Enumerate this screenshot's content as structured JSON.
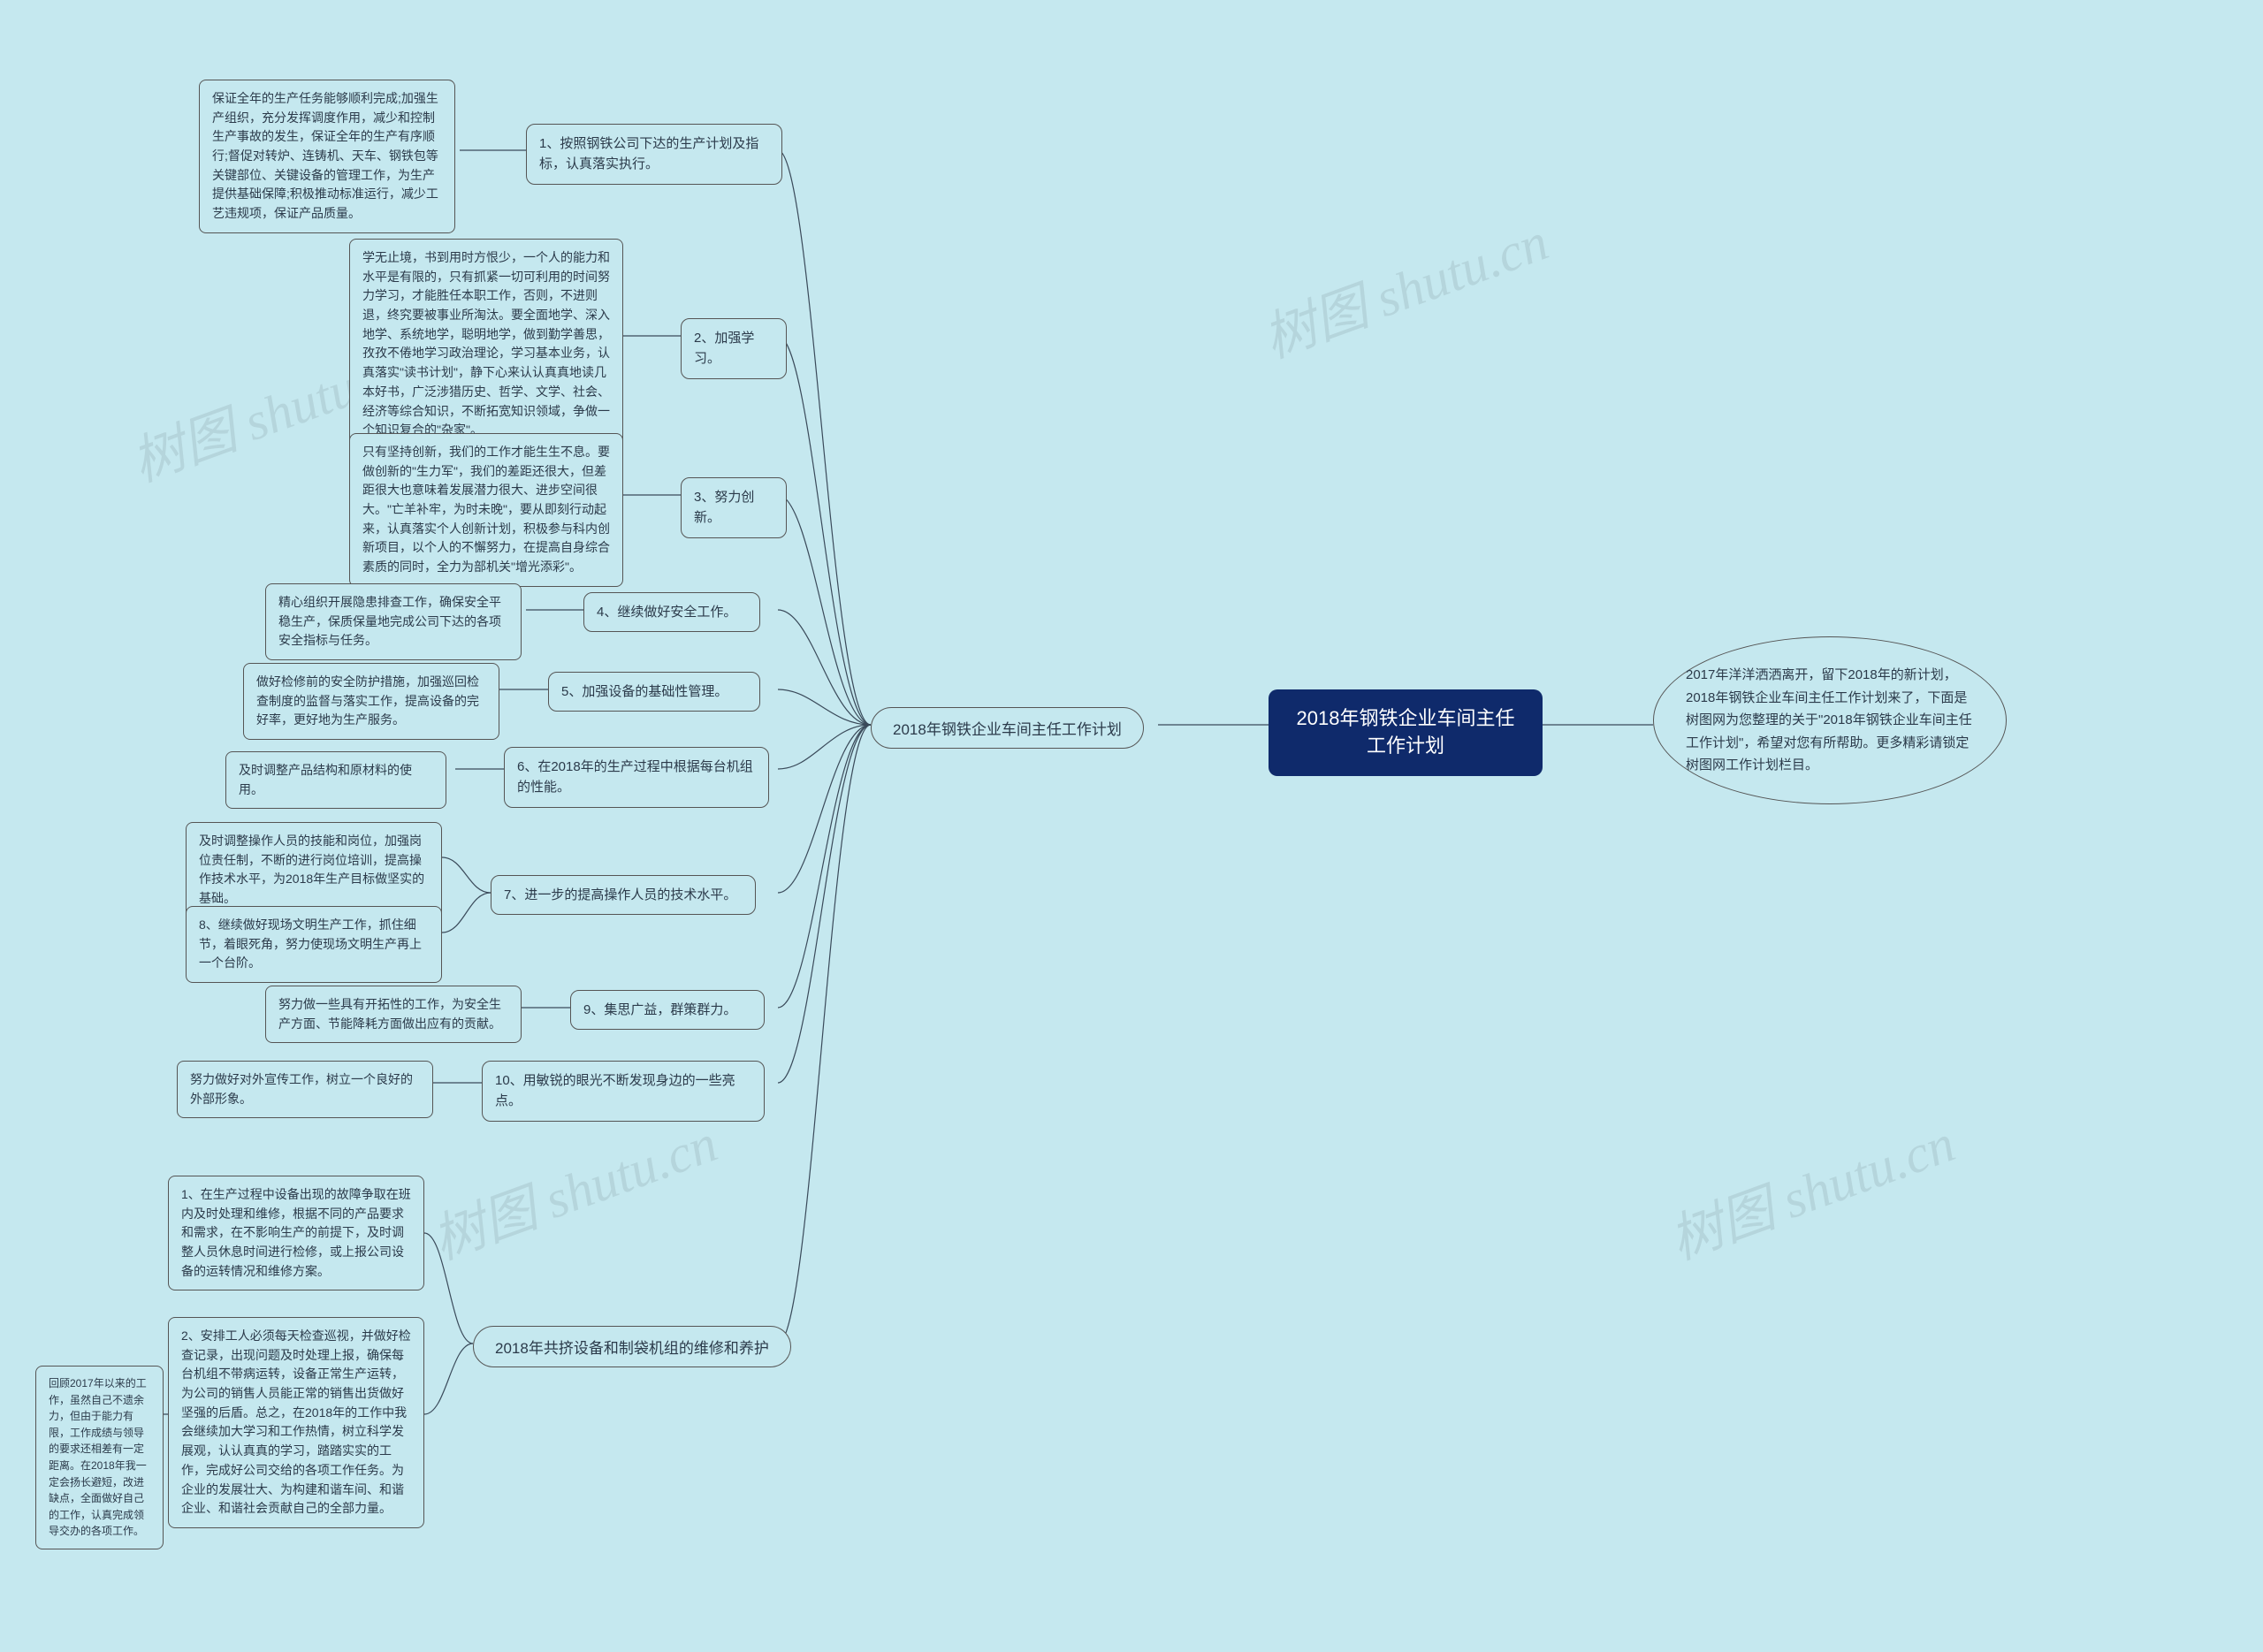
{
  "root": "2018年钢铁企业车间主任工作计划",
  "intro": "2017年洋洋洒洒离开，留下2018年的新计划，2018年钢铁企业车间主任工作计划来了，下面是树图网为您整理的关于\"2018年钢铁企业车间主任工作计划\"，希望对您有所帮助。更多精彩请锁定树图网工作计划栏目。",
  "branch_a": {
    "title": "2018年钢铁企业车间主任工作计划",
    "items": {
      "i1": {
        "label": "1、按照钢铁公司下达的生产计划及指标，认真落实执行。",
        "leaf": "保证全年的生产任务能够顺利完成;加强生产组织，充分发挥调度作用，减少和控制生产事故的发生，保证全年的生产有序顺行;督促对转炉、连铸机、天车、钢铁包等关键部位、关键设备的管理工作，为生产提供基础保障;积极推动标准运行，减少工艺违规项，保证产品质量。"
      },
      "i2": {
        "label": "2、加强学习。",
        "leaf": "学无止境，书到用时方恨少，一个人的能力和水平是有限的，只有抓紧一切可利用的时间努力学习，才能胜任本职工作，否则，不进则退，终究要被事业所淘汰。要全面地学、深入地学、系统地学，聪明地学，做到勤学善思，孜孜不倦地学习政治理论，学习基本业务，认真落实\"读书计划\"，静下心来认认真真地读几本好书，广泛涉猎历史、哲学、文学、社会、经济等综合知识，不断拓宽知识领域，争做一个知识复合的\"杂家\"。"
      },
      "i3": {
        "label": "3、努力创新。",
        "leaf": "只有坚持创新，我们的工作才能生生不息。要做创新的\"生力军\"，我们的差距还很大，但差距很大也意味着发展潜力很大、进步空间很大。\"亡羊补牢，为时未晚\"，要从即刻行动起来，认真落实个人创新计划，积极参与科内创新项目，以个人的不懈努力，在提高自身综合素质的同时，全力为部机关\"增光添彩\"。"
      },
      "i4": {
        "label": "4、继续做好安全工作。",
        "leaf": "精心组织开展隐患排查工作，确保安全平稳生产，保质保量地完成公司下达的各项安全指标与任务。"
      },
      "i5": {
        "label": "5、加强设备的基础性管理。",
        "leaf": "做好检修前的安全防护措施，加强巡回检查制度的监督与落实工作，提高设备的完好率，更好地为生产服务。"
      },
      "i6": {
        "label": "6、在2018年的生产过程中根据每台机组的性能。",
        "leaf": "及时调整产品结构和原材料的使用。"
      },
      "i7": {
        "label": "7、进一步的提高操作人员的技术水平。",
        "leaf1": "及时调整操作人员的技能和岗位，加强岗位责任制，不断的进行岗位培训，提高操作技术水平，为2018年生产目标做坚实的基础。",
        "leaf2": "8、继续做好现场文明生产工作，抓住细节，着眼死角，努力使现场文明生产再上一个台阶。"
      },
      "i9": {
        "label": "9、集思广益，群策群力。",
        "leaf": "努力做一些具有开拓性的工作，为安全生产方面、节能降耗方面做出应有的贡献。"
      },
      "i10": {
        "label": "10、用敏锐的眼光不断发现身边的一些亮点。",
        "leaf": "努力做好对外宣传工作，树立一个良好的外部形象。"
      }
    }
  },
  "branch_b": {
    "title": "2018年共挤设备和制袋机组的维修和养护",
    "items": {
      "b1": "1、在生产过程中设备出现的故障争取在班内及时处理和维修，根据不同的产品要求和需求，在不影响生产的前提下，及时调整人员休息时间进行检修，或上报公司设备的运转情况和维修方案。",
      "b2": "2、安排工人必须每天检查巡视，并做好检查记录，出现问题及时处理上报，确保每台机组不带病运转，设备正常生产运转，为公司的销售人员能正常的销售出货做好坚强的后盾。总之，在2018年的工作中我会继续加大学习和工作热情，树立科学发展观，认认真真的学习，踏踏实实的工作，完成好公司交给的各项工作任务。为企业的发展壮大、为构建和谐车间、和谐企业、和谐社会贡献自己的全部力量。",
      "b3_leaf": "回顾2017年以来的工作，虽然自己不遗余力，但由于能力有限，工作成绩与领导的要求还相差有一定距离。在2018年我一定会扬长避短，改进缺点，全面做好自己的工作，认真完成领导交办的各项工作。"
    }
  },
  "watermark": "树图 shutu.cn"
}
